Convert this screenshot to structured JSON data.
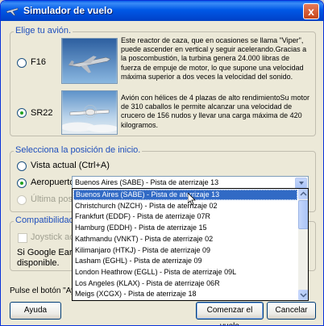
{
  "window": {
    "title": "Simulador de vuelo",
    "close_label": "x"
  },
  "aircraft_group": {
    "label": "Elige tu avión.",
    "options": [
      {
        "name": "F16",
        "checked": false,
        "description": "Este reactor de caza, que en ocasiones se llama \"Viper\", puede ascender en vertical y seguir acelerando.Gracias a la poscombustión, la turbina genera 24.000 libras de fuerza de empuje de motor, lo que supone una velocidad máxima superior a dos veces la velocidad del sonido."
      },
      {
        "name": "SR22",
        "checked": true,
        "description": "Avión con hélices de 4 plazas de alto rendimientoSu motor de 310 caballos le permite alcanzar una velocidad de crucero de 156 nudos y llevar una carga máxima de 420 kilogramos."
      }
    ]
  },
  "position_group": {
    "label": "Selecciona la posición de inicio.",
    "current_view": "Vista actual (Ctrl+A)",
    "airport_label": "Aeropuerto",
    "last_position": "Última posició",
    "selected_airport": "Buenos Aires (SABE) - Pista de aterrizaje 13"
  },
  "airport_list": [
    "Buenos Aires (SABE) - Pista de aterrizaje 13",
    "Christchurch (NZCH) - Pista de aterrizaje 02",
    "Frankfurt (EDDF) - Pista de aterrizaje 07R",
    "Hamburg (EDDH) - Pista de aterrizaje 15",
    "Kathmandu (VNKT) - Pista de aterrizaje 02",
    "Kilimanjaro (HTKJ) - Pista de aterrizaje 09",
    "Lasham (EGHL) - Pista de aterrizaje 09",
    "London Heathrow (EGLL) - Pista de aterrizaje 09L",
    "Los Angeles (KLAX) - Pista de aterrizaje 06R",
    "Meigs (XCGX) - Pista de aterrizaje 18"
  ],
  "compat_group": {
    "label": "Compatibilidad con",
    "joystick": "Joystick activ",
    "note_line1": "Si Google Earth no",
    "note_line2": "disponible."
  },
  "footer_note": "Pulse el botón \"Ayud",
  "buttons": {
    "help": "Ayuda",
    "start": "Comenzar el vuelo",
    "cancel": "Cancelar"
  },
  "colors": {
    "titlebar": "#0058e6",
    "group_label": "#1f4fbd",
    "selection": "#316ac5"
  }
}
